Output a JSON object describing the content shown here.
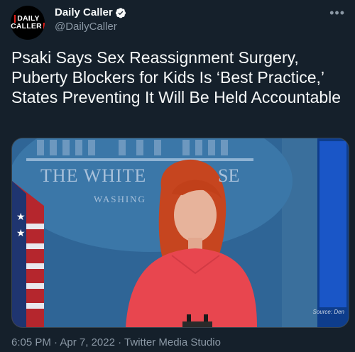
{
  "tweet": {
    "avatar_line1": "DAILY",
    "avatar_line2": "CALLER",
    "display_name": "Daily Caller",
    "handle": "@DailyCaller",
    "more_icon": "more-horizontal-icon",
    "text": "Psaki Says Sex Reassignment Surgery, Puberty Blockers for Kids Is ‘Best Practice,’ States Preventing It Will Be Held Accountable",
    "media": {
      "wall_line1": "THE WHITE",
      "wall_line1b": "SE",
      "wall_line2": "WASHING",
      "source_label": "Source: Den"
    },
    "time": "6:05 PM",
    "separator": "·",
    "date": "Apr 7, 2022",
    "source_app": "Twitter Media Studio"
  },
  "colors": {
    "background": "#15202b",
    "verified": "#1d9bf0",
    "secondary_text": "#8b98a5",
    "brand_red": "#e0201b"
  }
}
